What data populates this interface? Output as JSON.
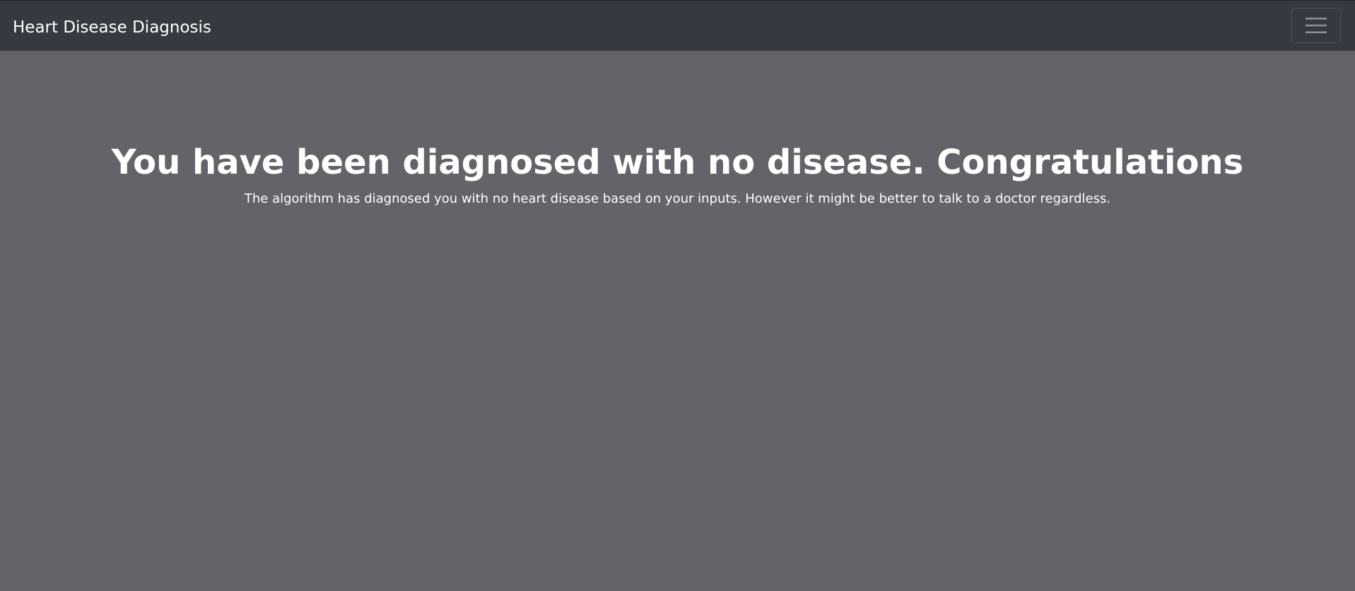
{
  "navbar": {
    "brand": "Heart Disease Diagnosis",
    "toggler_icon": "hamburger-menu-icon"
  },
  "result": {
    "headline": "You have been diagnosed with no disease. Congratulations",
    "message": "The algorithm has diagnosed you with no heart disease based on your inputs. However it might be better to talk to a doctor regardless."
  },
  "colors": {
    "navbar_background": "#343a40",
    "page_background": "#636469",
    "text": "#ffffff",
    "toggler_icon": "#8c9196"
  }
}
